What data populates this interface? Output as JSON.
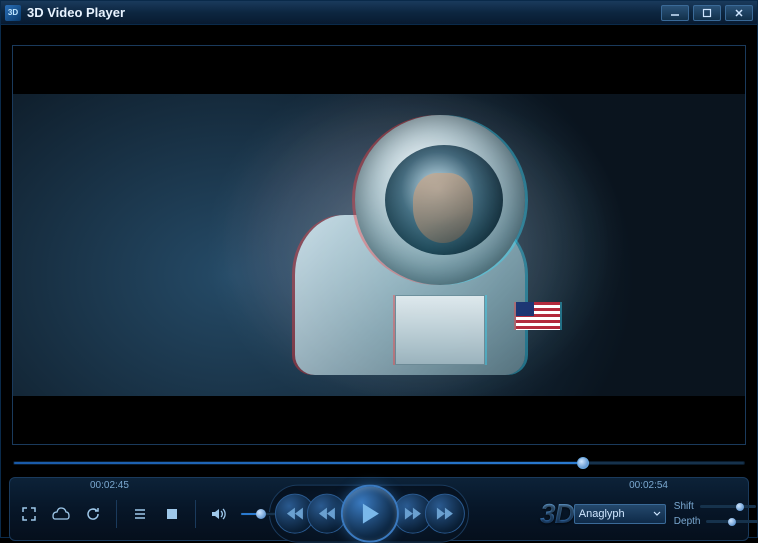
{
  "window": {
    "title": "3D Video Player",
    "icon_label": "3D"
  },
  "playback": {
    "current_time": "00:02:45",
    "total_time": "00:02:54",
    "progress_percent": 78,
    "volume_percent": 35
  },
  "mode_select": {
    "selected": "Anaglyph"
  },
  "sliders": {
    "shift": {
      "label": "Shift",
      "value_percent": 72
    },
    "depth": {
      "label": "Depth",
      "value_percent": 45
    }
  },
  "buttons": {
    "threeD": "3D"
  },
  "colors": {
    "accent": "#2a7ad0",
    "panel": "#0c2238"
  }
}
